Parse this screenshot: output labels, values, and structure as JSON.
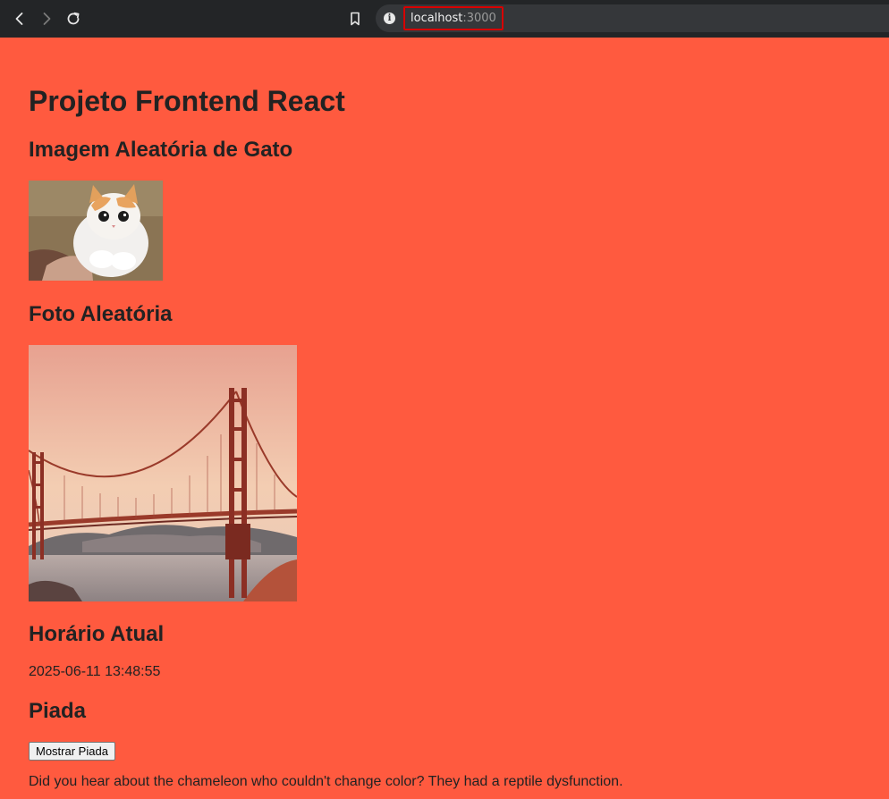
{
  "browser": {
    "url_host": "localhost",
    "url_port": ":3000",
    "icons": [
      "back-icon",
      "forward-icon",
      "reload-icon",
      "bookmark-icon",
      "info-icon"
    ]
  },
  "page": {
    "title": "Projeto Frontend React",
    "cat_section": {
      "heading": "Imagem Aleatória de Gato"
    },
    "photo_section": {
      "heading": "Foto Aleatória"
    },
    "time_section": {
      "heading": "Horário Atual",
      "value": "2025-06-11 13:48:55"
    },
    "joke_section": {
      "heading": "Piada",
      "button_label": "Mostrar Piada",
      "joke": "Did you hear about the chameleon who couldn't change color? They had a reptile dysfunction."
    }
  },
  "colors": {
    "background": "#ff5a3f",
    "text": "#222222"
  }
}
